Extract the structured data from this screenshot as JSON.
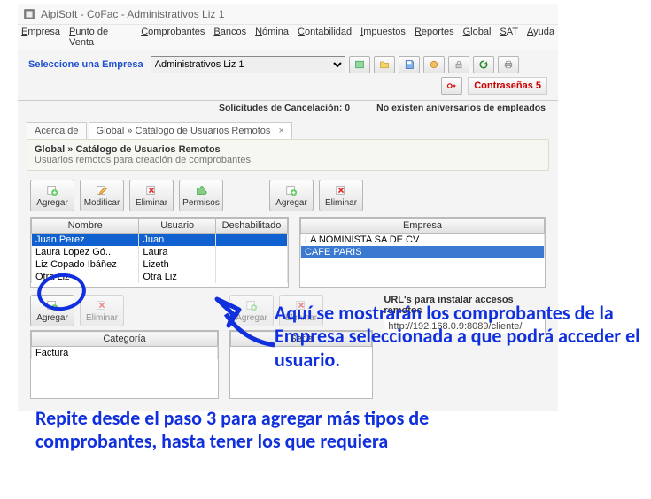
{
  "title": "AipiSoft - CoFac - Administrativos Liz 1",
  "menu": [
    "Empresa",
    "Punto de Venta",
    "Comprobantes",
    "Bancos",
    "Nómina",
    "Contabilidad",
    "Impuestos",
    "Reportes",
    "Global",
    "SAT",
    "Ayuda"
  ],
  "company_label": "Seleccione una Empresa",
  "company_selected": "Administrativos Liz 1",
  "contrasenas": "Contraseñas 5",
  "info_cancel": "Solicitudes de Cancelación: 0",
  "info_aniv": "No existen aniversarios de empleados",
  "tabs": {
    "acerca": "Acerca de",
    "catalogo": "Global » Catálogo de Usuarios Remotos"
  },
  "hdr_title": "Global » Catálogo de Usuarios Remotos",
  "hdr_sub": "Usuarios remotos para creación de comprobantes",
  "buttons": {
    "agregar": "Agregar",
    "modificar": "Modificar",
    "eliminar": "Eliminar",
    "permisos": "Permisos"
  },
  "users_cols": [
    "Nombre",
    "Usuario",
    "Deshabilitado"
  ],
  "users": [
    {
      "nombre": "Juan Perez",
      "usuario": "Juan",
      "dis": "",
      "sel": true
    },
    {
      "nombre": "Laura Lopez Gó...",
      "usuario": "Laura",
      "dis": ""
    },
    {
      "nombre": "Liz Copado Ibáñez",
      "usuario": "Lizeth",
      "dis": ""
    },
    {
      "nombre": "Otra Liz",
      "usuario": "Otra Liz",
      "dis": ""
    }
  ],
  "empresa_col": "Empresa",
  "empresas": [
    {
      "name": "LA NOMINISTA SA DE CV"
    },
    {
      "name": "CAFE PARIS",
      "sel": true
    }
  ],
  "categoria_col": "Categoría",
  "categoria_rows": [
    "Factura"
  ],
  "serie_col": "Serie",
  "url_label": "URL's para instalar accesos remotos",
  "url_value": "http://192.168.0.9:8089/cliente/",
  "annotation1": "Aquí se mostrarán los comprobantes de la Empresa seleccionada a que podrá acceder el usuario.",
  "annotation2": "Repite desde el paso 3 para agregar más tipos de comprobantes, hasta tener los que requiera"
}
